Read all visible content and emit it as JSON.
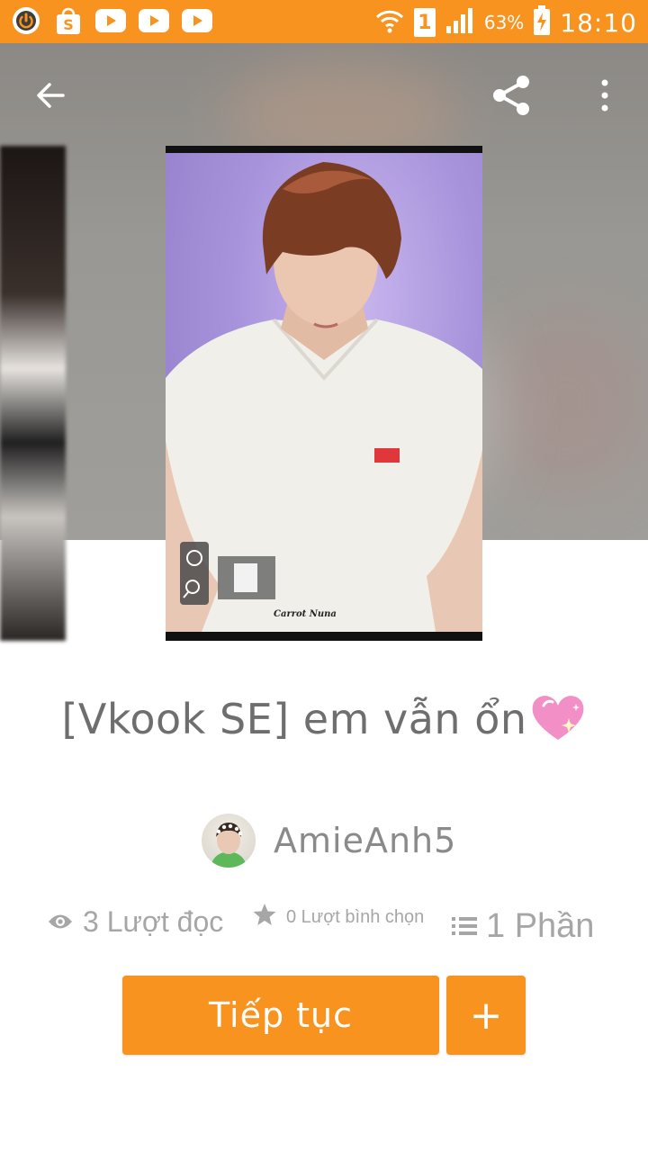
{
  "status_bar": {
    "battery": "63%",
    "time": "18:10",
    "sim_badge": "1",
    "notification_icons": [
      "power-app-icon",
      "shopee-icon",
      "youtube-icon",
      "youtube-icon",
      "youtube-icon"
    ],
    "status_icons": [
      "wifi-icon",
      "signal-icon",
      "battery-charging-icon"
    ]
  },
  "header": {
    "back_icon": "arrow-left-icon",
    "share_icon": "share-icon",
    "more_icon": "more-vertical-icon"
  },
  "cover": {
    "watermark": "Carrot Nuna"
  },
  "story": {
    "title": "[Vkook SE] em vẫn ổn",
    "title_emoji_icon": "sparkling-heart-icon",
    "author": "AmieAnh5"
  },
  "stats": {
    "reads": "3 Lượt đọc",
    "votes": "0 Lượt bình chọn",
    "parts": "1 Phần"
  },
  "actions": {
    "continue_label": "Tiếp tục",
    "add_label": "+"
  },
  "colors": {
    "accent": "#f7931e",
    "title_text": "#6e6e6e",
    "muted_text": "#a6a6a6"
  }
}
